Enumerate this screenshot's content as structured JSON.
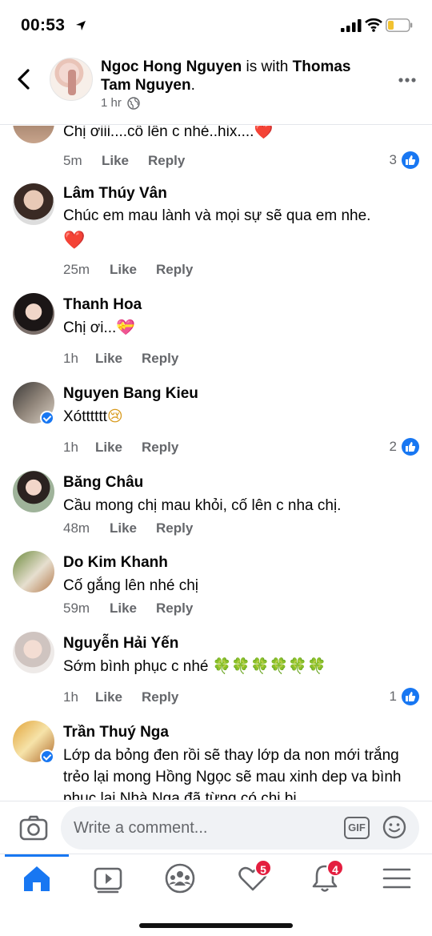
{
  "status_bar": {
    "time": "00:53"
  },
  "header": {
    "poster": "Ngoc Hong Nguyen",
    "with_text": " is with ",
    "tagged": "Thomas Tam Nguyen",
    "period": ".",
    "time": "1 hr"
  },
  "comments": [
    {
      "name": "",
      "text": "Chị ơiii....cố lên c nhé..hix....",
      "emoji": "❤️",
      "time": "5m",
      "reactions": "3"
    },
    {
      "name": "Lâm Thúy Vân",
      "text": "Chúc em mau lành và mọi sự sẽ qua em nhe.",
      "emoji": "❤️",
      "time": "25m",
      "reactions": ""
    },
    {
      "name": "Thanh Hoa",
      "text": "Chị ơi...",
      "emoji": "💝",
      "time": "1h",
      "reactions": ""
    },
    {
      "name": "Nguyen Bang Kieu",
      "text": "Xótttttt",
      "emoji": "😢",
      "time": "1h",
      "reactions": "2"
    },
    {
      "name": "Băng Châu",
      "text": "Cầu mong chị mau khỏi, cố lên c nha chị.",
      "emoji": "",
      "time": "48m",
      "reactions": ""
    },
    {
      "name": "Do Kim Khanh",
      "text": "Cố gắng lên nhé chị",
      "emoji": "",
      "time": "59m",
      "reactions": ""
    },
    {
      "name": "Nguyễn Hải Yến",
      "text": "Sớm bình phục c nhé",
      "emoji": "🍀🍀🍀🍀🍀🍀",
      "time": "1h",
      "reactions": "1"
    },
    {
      "name": "Trần Thuý Nga",
      "text": "Lớp da bỏng đen rồi sẽ thay lớp da non mới trắng trẻo lại mong Hồng Ngọc sẽ mau xinh dep va bình phuc lai.Nhà Nga đã từng có chi bi",
      "emoji": "",
      "time": "",
      "reactions": ""
    }
  ],
  "actions": {
    "like": "Like",
    "reply": "Reply"
  },
  "composer": {
    "placeholder": "Write a comment...",
    "gif_label": "GIF"
  },
  "tabbar": {
    "items": [
      {
        "icon": "home-icon"
      },
      {
        "icon": "watch-icon"
      },
      {
        "icon": "groups-icon"
      },
      {
        "icon": "dating-heart-icon",
        "badge": "5"
      },
      {
        "icon": "notifications-icon",
        "badge": "4"
      },
      {
        "icon": "menu-icon"
      }
    ]
  },
  "colors": {
    "accent": "#1877f2",
    "badge": "#e41e3f",
    "meta": "#65676b"
  }
}
